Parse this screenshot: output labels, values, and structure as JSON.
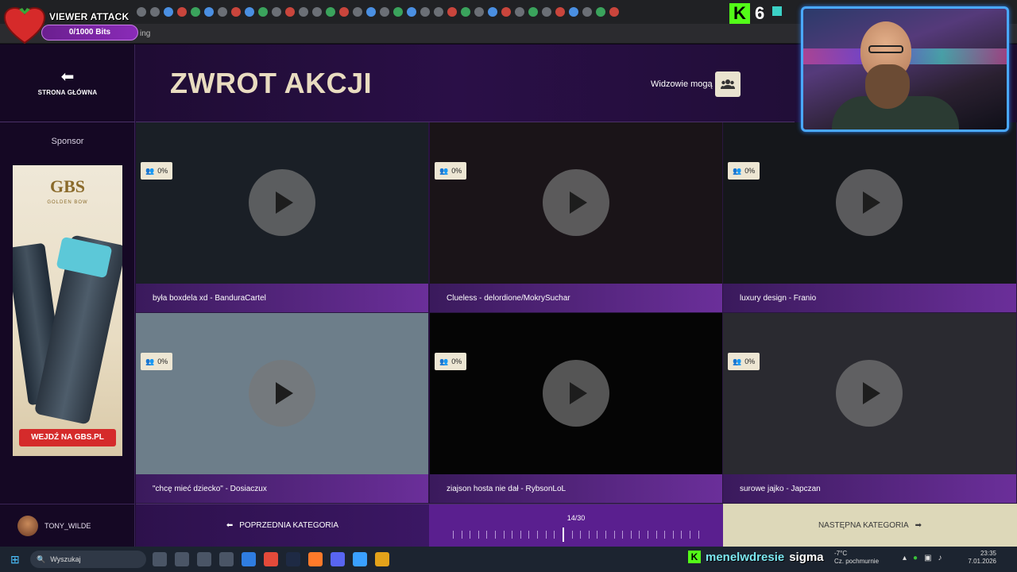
{
  "overlay": {
    "viewer_attack_title": "VIEWER ATTACK",
    "viewer_attack_bits": "0/1000 Bits",
    "kick_viewers": "6"
  },
  "browser": {
    "tab_fragment": "ing"
  },
  "nav": {
    "back_label": "STRONA GŁÓWNA",
    "sponsor_label": "Sponsor",
    "ad_brand": "GBS",
    "ad_tagline": "GOLDEN BOW",
    "ad_cta": "WEJDŹ NA GBS.PL"
  },
  "header": {
    "title": "ZWROT AKCJI",
    "visibility_label": "Widzowie mogą"
  },
  "tiles": [
    {
      "caption": "była boxdela xd - BanduraCartel",
      "percent": "0%",
      "bg": "#1a1f26"
    },
    {
      "caption": "Clueless - delordione/MokrySuchar",
      "percent": "0%",
      "bg": "#1a1418"
    },
    {
      "caption": "luxury design - Franio",
      "percent": "0%",
      "bg": "#15171b"
    },
    {
      "caption": "\"chcę mieć dziecko\" - Dosiaczux",
      "percent": "0%",
      "bg": "#6d7e8a"
    },
    {
      "caption": "ziajson hosta nie dał - RybsonLoL",
      "percent": "0%",
      "bg": "#050505"
    },
    {
      "caption": "surowe jajko - Japczan",
      "percent": "0%",
      "bg": "#2a2a30"
    }
  ],
  "user": {
    "name": "TONY_WILDE"
  },
  "footer": {
    "prev_label": "POPRZEDNIA KATEGORIA",
    "next_label": "NASTĘPNA KATEGORIA",
    "page_text": "14/30",
    "page_current": 14,
    "page_total": 30
  },
  "taskbar": {
    "search_placeholder": "Wyszukaj",
    "ticker_user": "menelwdresie",
    "ticker_word": "sigma",
    "weather_temp": "-7°C",
    "weather_desc": "Cz. pochmurnie",
    "time": "23:35",
    "date": "7.01.2026"
  },
  "colors": {
    "accent_purple": "#6b2f9a",
    "title_cream": "#e9dcc0",
    "kick_green": "#53fc18"
  }
}
